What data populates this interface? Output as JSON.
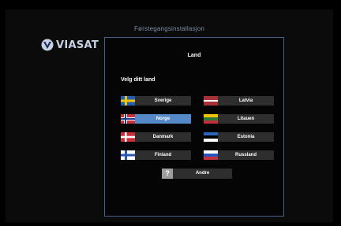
{
  "header": {
    "title": "Førstegangsinstallasjon"
  },
  "brand": {
    "name": "VIASAT"
  },
  "dialog": {
    "title": "Land",
    "prompt": "Velg ditt land",
    "selected": "Norge",
    "countries": [
      {
        "label": "Sverige",
        "flag": "sweden-flag-icon"
      },
      {
        "label": "Latvia",
        "flag": "latvia-flag-icon"
      },
      {
        "label": "Norge",
        "flag": "norway-flag-icon"
      },
      {
        "label": "Litauen",
        "flag": "lithuania-flag-icon"
      },
      {
        "label": "Danmark",
        "flag": "denmark-flag-icon"
      },
      {
        "label": "Estonia",
        "flag": "estonia-flag-icon"
      },
      {
        "label": "Finland",
        "flag": "finland-flag-icon"
      },
      {
        "label": "Russland",
        "flag": "russia-flag-icon"
      }
    ],
    "other": {
      "label": "Andre",
      "icon_text": "?"
    }
  },
  "colors": {
    "selected": "#5589c8",
    "button": "#2e2e2e",
    "panel_border": "#4a6088"
  }
}
